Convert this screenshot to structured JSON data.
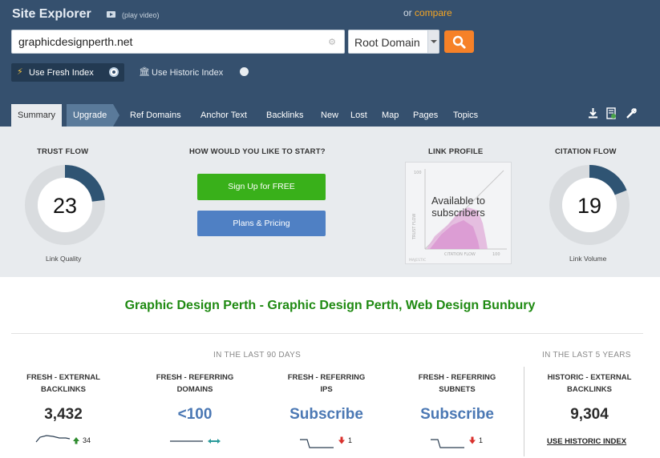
{
  "header": {
    "app_title": "Site Explorer",
    "play_video_label": "(play video)",
    "compare_prefix": "or",
    "compare_link": "compare",
    "search_value": "graphicdesignperth.net",
    "domain_scope": "Root Domain",
    "fresh_index_label": "Use Fresh Index",
    "historic_index_label": "Use Historic Index",
    "selected_index": "fresh"
  },
  "tabs": [
    {
      "label": "Summary",
      "active": true
    },
    {
      "label": "Upgrade"
    },
    {
      "label": "Ref Domains"
    },
    {
      "label": "Anchor Text"
    },
    {
      "label": "Backlinks"
    },
    {
      "label": "New"
    },
    {
      "label": "Lost"
    },
    {
      "label": "Map"
    },
    {
      "label": "Pages"
    },
    {
      "label": "Topics"
    }
  ],
  "tool_icons": [
    "download-icon",
    "report-icon",
    "tools-icon"
  ],
  "stats": {
    "trust_flow": {
      "title": "TRUST FLOW",
      "value": "23",
      "caption": "Link Quality",
      "fraction": 0.23
    },
    "start": {
      "title": "HOW WOULD YOU LIKE TO START?",
      "signup_label": "Sign Up for FREE",
      "pricing_label": "Plans & Pricing"
    },
    "link_profile": {
      "title": "LINK PROFILE",
      "overlay_text": "Available to subscribers",
      "axis_y": "TRUST FLOW",
      "axis_x": "CITATION FLOW",
      "tick_100": "100",
      "brand": "MAJESTIC"
    },
    "citation_flow": {
      "title": "CITATION FLOW",
      "value": "19",
      "caption": "Link Volume",
      "fraction": 0.19
    }
  },
  "site_title": "Graphic Design Perth - Graphic Design Perth, Web Design Bunbury",
  "periods": {
    "recent": "IN THE LAST 90 DAYS",
    "historic": "IN THE LAST 5 YEARS"
  },
  "metrics": [
    {
      "label_line1": "FRESH - EXTERNAL",
      "label_line2": "BACKLINKS",
      "value": "3,432",
      "delta": "34",
      "trend": "up"
    },
    {
      "label_line1": "FRESH - REFERRING",
      "label_line2": "DOMAINS",
      "value": "<100",
      "trend": "flat"
    },
    {
      "label_line1": "FRESH - REFERRING",
      "label_line2": "IPS",
      "value": "Subscribe",
      "delta": "1",
      "trend": "down"
    },
    {
      "label_line1": "FRESH - REFERRING",
      "label_line2": "SUBNETS",
      "value": "Subscribe",
      "delta": "1",
      "trend": "down"
    },
    {
      "label_line1": "HISTORIC - EXTERNAL",
      "label_line2": "BACKLINKS",
      "value": "9,304",
      "link": "USE HISTORIC INDEX"
    }
  ],
  "colors": {
    "header": "#35506e",
    "accent": "#f68128",
    "trust_flow": "#2f5473",
    "title_green": "#1f8a12",
    "subscribe_blue": "#4b78b4"
  }
}
